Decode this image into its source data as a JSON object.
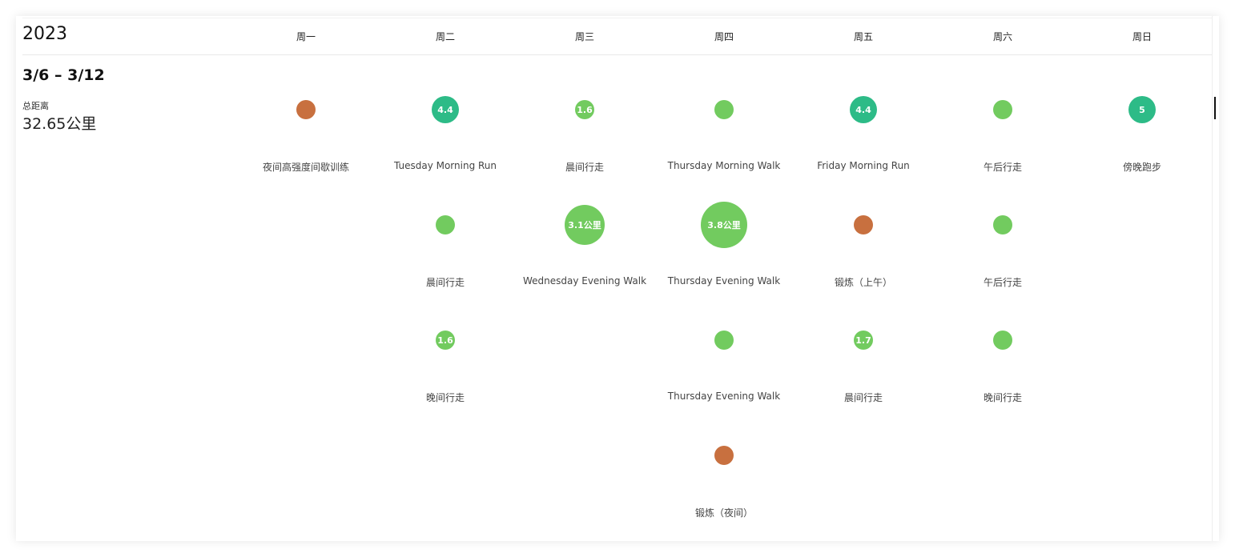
{
  "year": "2023",
  "weekdays": [
    "周一",
    "周二",
    "周三",
    "周四",
    "周五",
    "周六",
    "周日"
  ],
  "week": {
    "range": "3/6 – 3/12",
    "distance_label": "总距离",
    "distance_value": "32.65公里"
  },
  "colors": {
    "walk": "#72cb5f",
    "run": "#2dbb87",
    "workout": "#c8703f"
  },
  "activities": [
    {
      "day": 0,
      "row": 0,
      "name": "夜间高强度间歇训练",
      "label": "",
      "type": "workout",
      "size": "s"
    },
    {
      "day": 1,
      "row": 0,
      "name": "Tuesday Morning Run",
      "label": "4.4",
      "type": "run",
      "size": "m"
    },
    {
      "day": 1,
      "row": 1,
      "name": "晨间行走",
      "label": "",
      "type": "walk",
      "size": "s"
    },
    {
      "day": 1,
      "row": 2,
      "name": "晚间行走",
      "label": "1.6",
      "type": "walk",
      "size": "s"
    },
    {
      "day": 2,
      "row": 0,
      "name": "晨间行走",
      "label": "1.6",
      "type": "walk",
      "size": "s"
    },
    {
      "day": 2,
      "row": 1,
      "name": "Wednesday Evening Walk",
      "label": "3.1公里",
      "type": "walk",
      "size": "l"
    },
    {
      "day": 3,
      "row": 0,
      "name": "Thursday Morning Walk",
      "label": "",
      "type": "walk",
      "size": "s"
    },
    {
      "day": 3,
      "row": 1,
      "name": "Thursday Evening Walk",
      "label": "3.8公里",
      "type": "walk",
      "size": "xl"
    },
    {
      "day": 3,
      "row": 2,
      "name": "Thursday Evening Walk",
      "label": "",
      "type": "walk",
      "size": "s"
    },
    {
      "day": 3,
      "row": 3,
      "name": "锻炼（夜间）",
      "label": "",
      "type": "workout",
      "size": "s"
    },
    {
      "day": 4,
      "row": 0,
      "name": "Friday Morning Run",
      "label": "4.4",
      "type": "run",
      "size": "m"
    },
    {
      "day": 4,
      "row": 1,
      "name": "锻炼（上午）",
      "label": "",
      "type": "workout",
      "size": "s"
    },
    {
      "day": 4,
      "row": 2,
      "name": "晨间行走",
      "label": "1.7",
      "type": "walk",
      "size": "s"
    },
    {
      "day": 5,
      "row": 0,
      "name": "午后行走",
      "label": "",
      "type": "walk",
      "size": "s"
    },
    {
      "day": 5,
      "row": 1,
      "name": "午后行走",
      "label": "",
      "type": "walk",
      "size": "s"
    },
    {
      "day": 5,
      "row": 2,
      "name": "晚间行走",
      "label": "",
      "type": "walk",
      "size": "s"
    },
    {
      "day": 6,
      "row": 0,
      "name": "傍晚跑步",
      "label": "5",
      "type": "run",
      "size": "m"
    }
  ]
}
